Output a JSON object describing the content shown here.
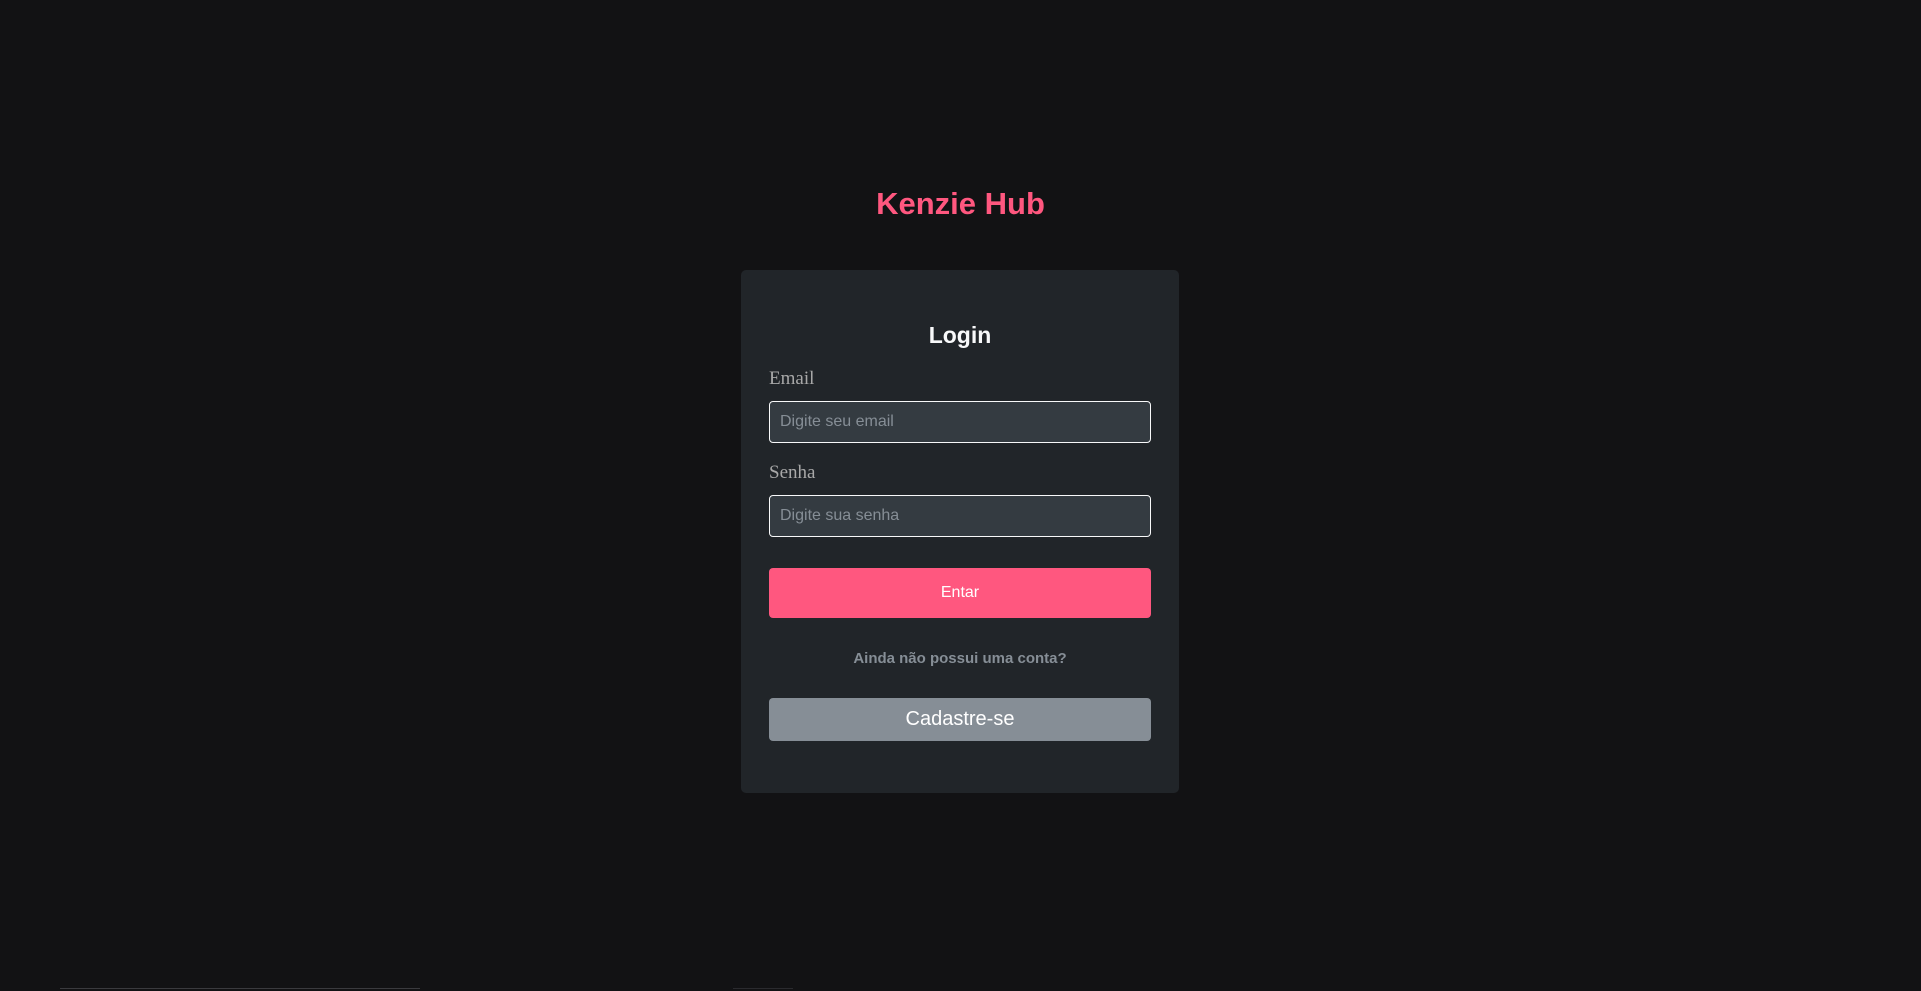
{
  "brand": {
    "title": "Kenzie Hub",
    "color": "#FF577F"
  },
  "login_form": {
    "title": "Login",
    "email": {
      "label": "Email",
      "value": "",
      "placeholder": "Digite seu email"
    },
    "password": {
      "label": "Senha",
      "value": "",
      "placeholder": "Digite sua senha"
    },
    "submit_label": "Entar",
    "signup_hint": "Ainda não possui uma conta?",
    "signup_label": "Cadastre-se"
  },
  "colors": {
    "background": "#121214",
    "card": "#212529",
    "input_bg": "#343B41",
    "primary": "#FF577F",
    "secondary": "#868E96",
    "text_light": "#F8F9FA",
    "text_muted": "#868E96"
  }
}
